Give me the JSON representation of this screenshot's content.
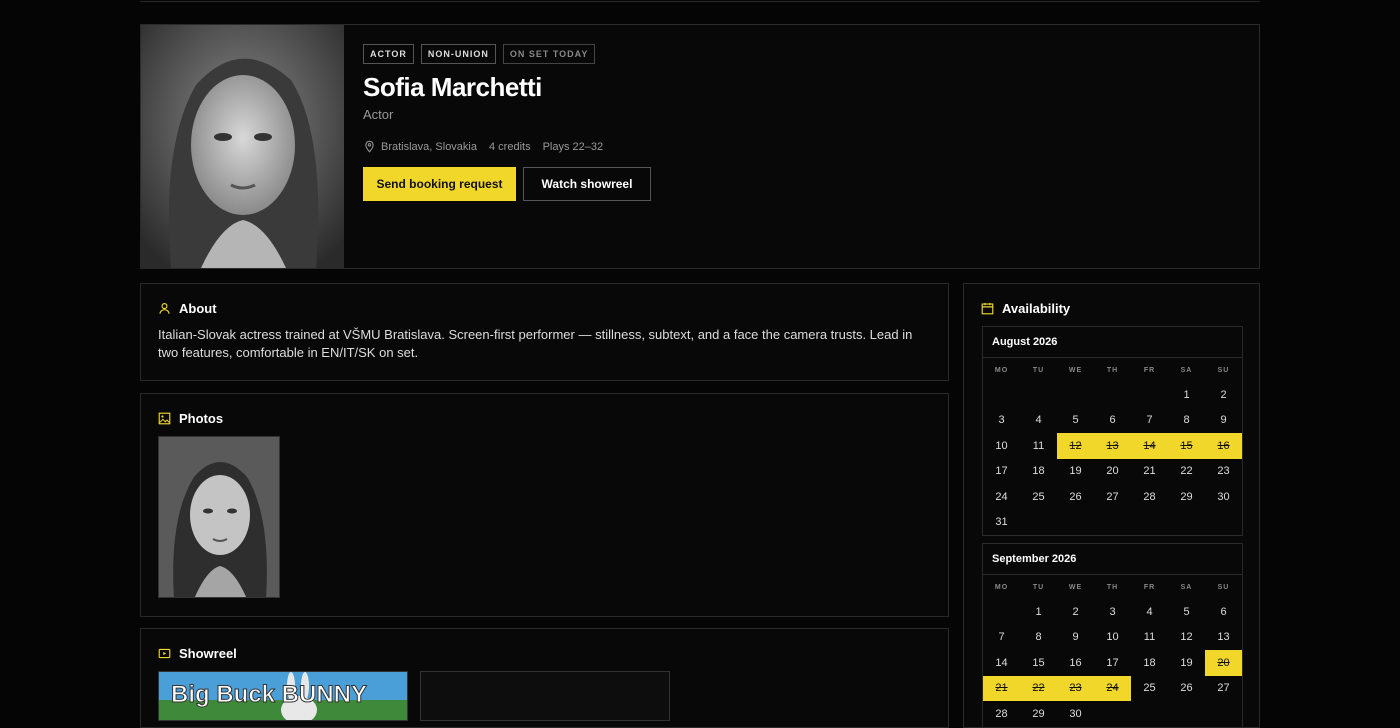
{
  "profile": {
    "badges": [
      "ACTOR",
      "NON-UNION",
      "ON SET TODAY"
    ],
    "name": "Sofia Marchetti",
    "role": "Actor",
    "location": "Bratislava, Slovakia",
    "credits": "4 credits",
    "plays": "Plays 22–32",
    "primary_button": "Send booking request",
    "secondary_button": "Watch showreel"
  },
  "about": {
    "title": "About",
    "text": "Italian-Slovak actress trained at VŠMU Bratislava. Screen-first performer — stillness, subtext, and a face the camera trusts. Lead in two features, comfortable in EN/IT/SK on set."
  },
  "photos": {
    "title": "Photos"
  },
  "showreel": {
    "title": "Showreel",
    "thumb_text": "Big Buck BUNNY"
  },
  "availability": {
    "title": "Availability",
    "dow": [
      "MO",
      "TU",
      "WE",
      "TH",
      "FR",
      "SA",
      "SU"
    ],
    "months": [
      {
        "label": "August 2026",
        "offset": 5,
        "days": 31,
        "booked": [
          12,
          13,
          14,
          15,
          16
        ]
      },
      {
        "label": "September 2026",
        "offset": 1,
        "days": 30,
        "booked": [
          20,
          21,
          22,
          23,
          24
        ]
      }
    ]
  },
  "colors": {
    "accent": "#f2d72b",
    "bg": "#050505"
  }
}
